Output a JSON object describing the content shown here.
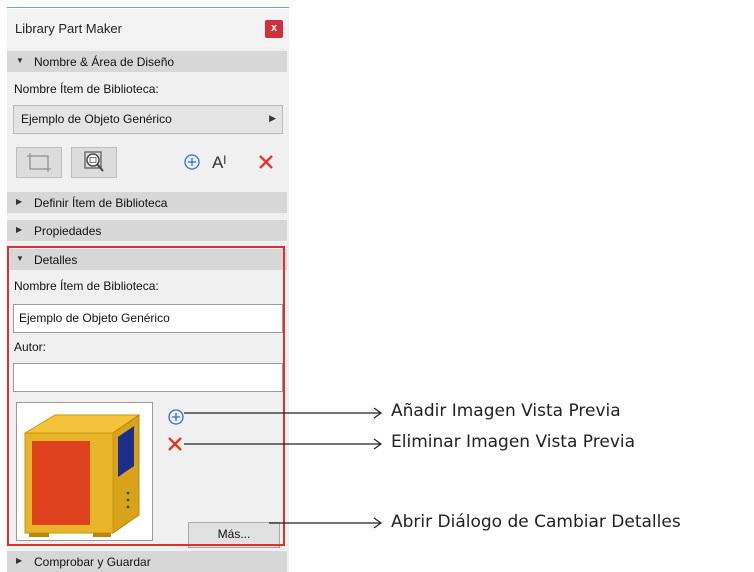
{
  "window": {
    "title": "Library Part Maker",
    "close_glyph": "x"
  },
  "sections": {
    "name_design": {
      "label": "Nombre & Área de Diseño",
      "expanded": true
    },
    "define": {
      "label": "Definir Ítem de Biblioteca",
      "expanded": false
    },
    "properties": {
      "label": "Propiedades",
      "expanded": false
    },
    "details": {
      "label": "Detalles",
      "expanded": true
    },
    "check_save": {
      "label": "Comprobar y Guardar",
      "expanded": false
    }
  },
  "name_design": {
    "field_label": "Nombre Ítem de Biblioteca:",
    "selected_item": "Ejemplo de Objeto Genérico",
    "text_tool_glyph": "Aᴵ"
  },
  "details": {
    "name_label": "Nombre Ítem de Biblioteca:",
    "name_value": "Ejemplo de Objeto Genérico",
    "author_label": "Autor:",
    "author_value": "",
    "more_button": "Más..."
  },
  "callouts": {
    "add_preview": "Añadir Imagen Vista Previa",
    "delete_preview": "Eliminar Imagen Vista Previa",
    "open_details": "Abrir Diálogo de Cambiar Detalles"
  },
  "colors": {
    "accent_blue": "#2f6fd6",
    "delete_red": "#e8352a",
    "highlight_red": "#e03030",
    "close_red": "#d0303e"
  },
  "icons": [
    "crop-frame-icon",
    "zoom-frame-icon",
    "add-icon",
    "text-cursor-icon",
    "delete-icon",
    "air-conditioner-preview"
  ]
}
